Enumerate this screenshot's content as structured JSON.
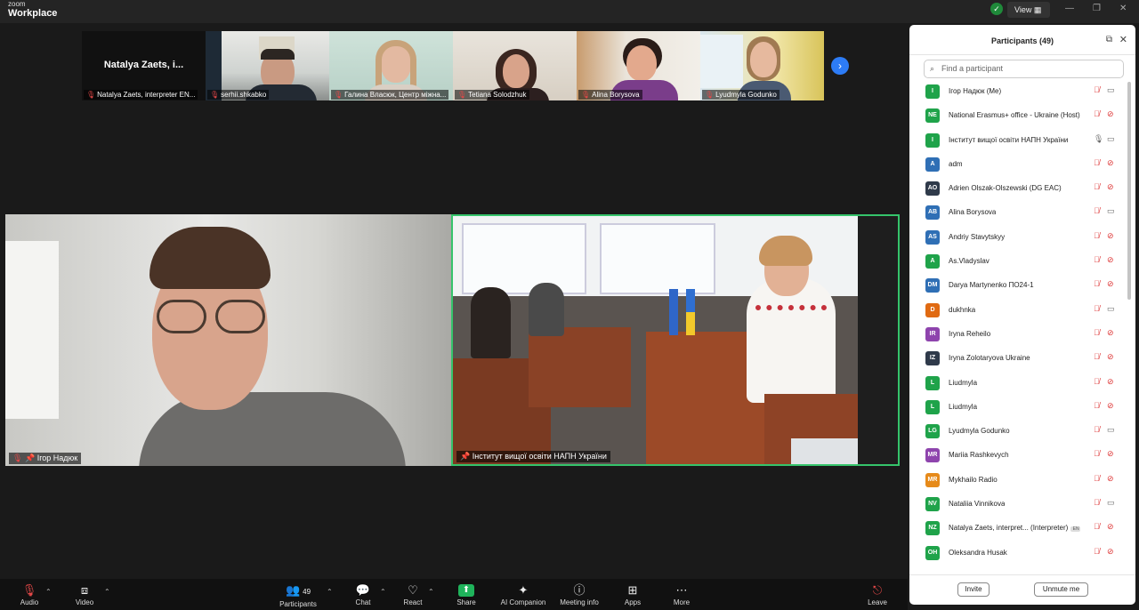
{
  "app": {
    "brand_small": "zoom",
    "brand_big": "Workplace",
    "view_label": "View"
  },
  "strip": {
    "thumbnails": [
      {
        "name": "Natalya Zaets, interpreter EN...",
        "big_name": "Natalya Zaets, i..."
      },
      {
        "name": "serhii.shkabko"
      },
      {
        "name": "Галина Власюк, Центр міжна..."
      },
      {
        "name": "Tetiana Solodzhuk"
      },
      {
        "name": "Alina Borysova"
      },
      {
        "name": "Lyudmyla Godunko"
      }
    ]
  },
  "tiles": {
    "left": {
      "name": "Ігор Надюк"
    },
    "right": {
      "name": "Інститут вищої освіти НАПН України"
    }
  },
  "toolbar": {
    "audio": "Audio",
    "video": "Video",
    "participants": "Participants",
    "participants_count": "49",
    "chat": "Chat",
    "react": "React",
    "share": "Share",
    "ai": "AI Companion",
    "meeting_info": "Meeting info",
    "apps": "Apps",
    "more": "More",
    "leave": "Leave"
  },
  "panel": {
    "title": "Participants (49)",
    "search_placeholder": "Find a participant",
    "invite": "Invite",
    "unmute_me": "Unmute me",
    "participants": [
      {
        "initials": "I",
        "color": "#1fa34a",
        "name": "Ігор Надюк (Me)",
        "mic": "muted",
        "cam": "on"
      },
      {
        "initials": "NE",
        "color": "#1fa34a",
        "name": "National Erasmus+ office - Ukraine (Host)",
        "mic": "muted",
        "cam": "off"
      },
      {
        "initials": "I",
        "color": "#1fa34a",
        "name": "Інститут вищої освіти НАПН України",
        "mic": "on",
        "cam": "on"
      },
      {
        "initials": "A",
        "color": "#2f6fb5",
        "name": "adm",
        "mic": "muted",
        "cam": "off"
      },
      {
        "initials": "AO",
        "color": "#2f3a4a",
        "name": "Adrien Olszak-Olszewski (DG EAC)",
        "mic": "muted",
        "cam": "off"
      },
      {
        "initials": "AB",
        "color": "#2f6fb5",
        "name": "Alina Borysova",
        "mic": "muted",
        "cam": "on"
      },
      {
        "initials": "AS",
        "color": "#2f6fb5",
        "name": "Andriy Stavytskyy",
        "mic": "muted",
        "cam": "off"
      },
      {
        "initials": "A",
        "color": "#1fa34a",
        "name": "As.Vladyslav",
        "mic": "muted",
        "cam": "off"
      },
      {
        "initials": "DM",
        "color": "#2f6fb5",
        "name": "Darya Martynenko ПО24-1",
        "mic": "muted",
        "cam": "off"
      },
      {
        "initials": "D",
        "color": "#e06a12",
        "name": "dukhnka",
        "mic": "muted",
        "cam": "on"
      },
      {
        "initials": "IR",
        "color": "#8e44ad",
        "name": "Iryna Reheilo",
        "mic": "muted",
        "cam": "off"
      },
      {
        "initials": "IZ",
        "color": "#2f3a4a",
        "name": "Iryna Zolotaryova Ukraine",
        "mic": "muted",
        "cam": "off"
      },
      {
        "initials": "L",
        "color": "#1fa34a",
        "name": "Liudmyla",
        "mic": "muted",
        "cam": "off"
      },
      {
        "initials": "L",
        "color": "#1fa34a",
        "name": "Liudmyla",
        "mic": "muted",
        "cam": "off"
      },
      {
        "initials": "LG",
        "color": "#1fa34a",
        "name": "Lyudmyla Godunko",
        "mic": "muted",
        "cam": "on"
      },
      {
        "initials": "MR",
        "color": "#8e44ad",
        "name": "Mariia Rashkevych",
        "mic": "muted",
        "cam": "off"
      },
      {
        "initials": "MR",
        "color": "#e68a1a",
        "name": "Mykhailo Radio",
        "mic": "muted",
        "cam": "off"
      },
      {
        "initials": "NV",
        "color": "#1fa34a",
        "name": "Nataliia Vinnikova",
        "mic": "muted",
        "cam": "on"
      },
      {
        "initials": "NZ",
        "color": "#1fa34a",
        "name": "Natalya Zaets, interpret... (Interpreter)",
        "badge": "EN",
        "mic": "muted",
        "cam": "off"
      },
      {
        "initials": "OH",
        "color": "#1fa34a",
        "name": "Oleksandra Husak",
        "mic": "muted",
        "cam": "off"
      }
    ]
  }
}
